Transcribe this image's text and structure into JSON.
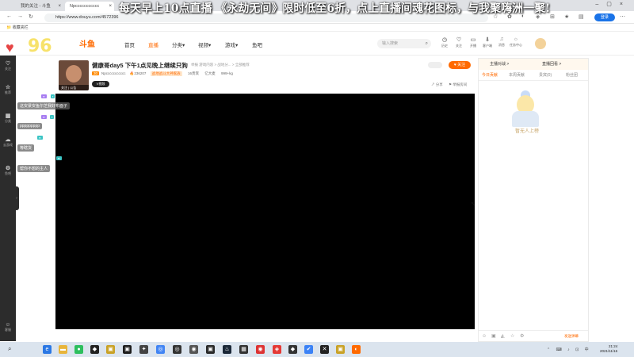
{
  "browser": {
    "tabs": [
      {
        "title": "我的关注 - 斗鱼",
        "active": false
      },
      {
        "title": "Npccccccccccc",
        "active": true
      }
    ],
    "url": "https://www.douyu.com/4572396",
    "bookmark": "收藏夹栏",
    "login_label": "登录"
  },
  "banner_text": "每天早上10点直播 《永劫无间》限时低至6折，点上直播间魂花图标，与我聚嗨洲一聚!",
  "overlay_logo": "96",
  "site": {
    "brand": "斗鱼",
    "nav": [
      "首页",
      "直播",
      "分类▾",
      "视频▾",
      "游戏▾",
      "鱼吧"
    ],
    "search_placeholder": "输入搜索",
    "header_icons": [
      {
        "label": "历史",
        "icon": "clock-icon"
      },
      {
        "label": "关注",
        "icon": "heart-icon"
      },
      {
        "label": "开播",
        "icon": "camera-icon"
      },
      {
        "label": "客户端",
        "icon": "download-icon"
      },
      {
        "label": "消息",
        "icon": "bell-icon"
      },
      {
        "label": "任务中心",
        "icon": "bulb-icon"
      }
    ]
  },
  "left_rail": [
    {
      "label": "关注",
      "icon": "heart-icon"
    },
    {
      "label": "推荐",
      "icon": "star-icon"
    },
    {
      "label": "分类",
      "icon": "grid-icon"
    },
    {
      "label": "斗鱼",
      "icon": "fish-icon"
    },
    {
      "label": "云游戏",
      "icon": "cloud-icon"
    },
    {
      "label": "直播",
      "icon": "tv-icon"
    },
    {
      "label": "鱼吧",
      "icon": "chat-icon"
    },
    {
      "label": "客服",
      "icon": "support-icon"
    }
  ],
  "danmaku": [
    "这安景安鱼尔芝我好布面子",
    "ppppppppp",
    "等瞎货",
    "帮你不想的主人"
  ],
  "room": {
    "title": "健康哥day5 下午1点见晚上继续只狗",
    "subtitle": "举报  游戏内容 > 战地分... > 全部推荐",
    "anchor_name": "Npccccccccccc",
    "level": "30",
    "hot": "236207",
    "org_badge": "战地战斗大神家族",
    "fans": "16贵宾",
    "rank": "亿大麦",
    "points": "999+kg",
    "avatar_caption": "关注 | 公告",
    "v_label": "V视频",
    "follow_label": "关注",
    "share_label": "分享",
    "report_label": "举报房间"
  },
  "right_panel": {
    "anchor_tab": "主播对战 >",
    "rank_tab": "直播回看 >",
    "tabs": [
      "今日贡献",
      "本周贡献",
      "贵宾(0)",
      "粉丝团"
    ],
    "empty_text": "暂无人上榜",
    "send_label": "发送弹幕"
  },
  "taskbar": {
    "time": "21:24",
    "date": "2021/11/16"
  }
}
